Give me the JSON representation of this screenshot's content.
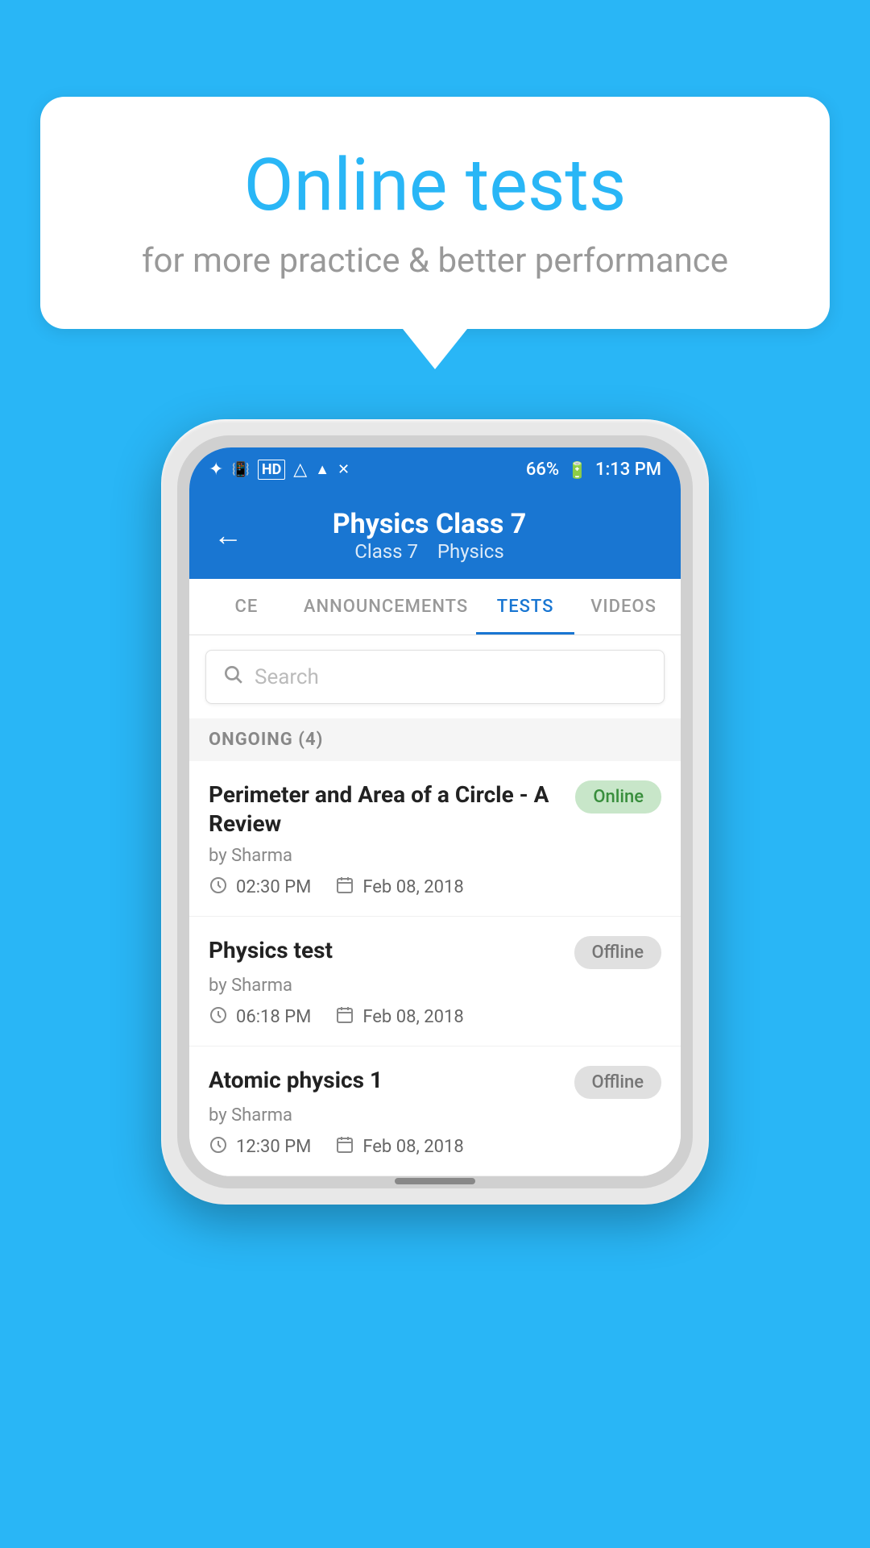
{
  "background_color": "#29b6f6",
  "bubble": {
    "title": "Online tests",
    "subtitle": "for more practice & better performance"
  },
  "status_bar": {
    "battery": "66%",
    "time": "1:13 PM",
    "icons": [
      "bluetooth",
      "vibrate",
      "hd",
      "wifi",
      "signal",
      "x-signal"
    ]
  },
  "app_bar": {
    "back_label": "←",
    "title": "Physics Class 7",
    "subtitle_class": "Class 7",
    "subtitle_sep": "  ",
    "subtitle_subject": "Physics"
  },
  "tabs": [
    {
      "label": "CE",
      "active": false
    },
    {
      "label": "ANNOUNCEMENTS",
      "active": false
    },
    {
      "label": "TESTS",
      "active": true
    },
    {
      "label": "VIDEOS",
      "active": false
    }
  ],
  "search": {
    "placeholder": "Search"
  },
  "section": {
    "label": "ONGOING (4)"
  },
  "tests": [
    {
      "title": "Perimeter and Area of a Circle - A Review",
      "author": "by Sharma",
      "status": "Online",
      "status_type": "online",
      "time": "02:30 PM",
      "date": "Feb 08, 2018"
    },
    {
      "title": "Physics test",
      "author": "by Sharma",
      "status": "Offline",
      "status_type": "offline",
      "time": "06:18 PM",
      "date": "Feb 08, 2018"
    },
    {
      "title": "Atomic physics 1",
      "author": "by Sharma",
      "status": "Offline",
      "status_type": "offline",
      "time": "12:30 PM",
      "date": "Feb 08, 2018"
    }
  ]
}
